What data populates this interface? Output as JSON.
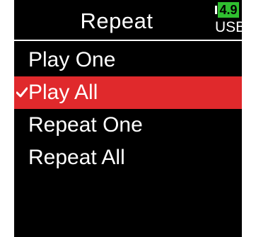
{
  "header": {
    "title": "Repeat"
  },
  "battery": {
    "level": "4.9",
    "source": "USB",
    "level_color": "#2fbf2f"
  },
  "menu": {
    "items": [
      {
        "label": "Play One",
        "selected": false
      },
      {
        "label": "Play All",
        "selected": true
      },
      {
        "label": "Repeat One",
        "selected": false
      },
      {
        "label": "Repeat All",
        "selected": false
      }
    ],
    "selected_color": "#e0292c",
    "selected_icon": "checkmark-icon"
  }
}
